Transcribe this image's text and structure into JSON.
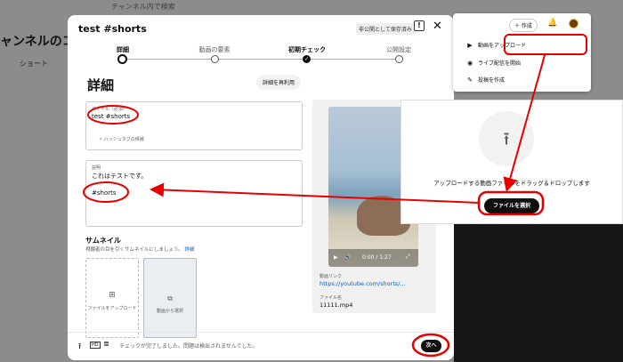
{
  "background": {
    "search_placeholder": "チャンネル内で検索",
    "channel_title": "ャンネルのコ",
    "tab_short": "ショート"
  },
  "dialog": {
    "title": "test #shorts",
    "saved_badge": "非公開として保存済み",
    "steps": [
      {
        "label": "詳細"
      },
      {
        "label": "動画の要素"
      },
      {
        "label": "初期チェック"
      },
      {
        "label": "公開設定"
      }
    ],
    "heading": "詳細",
    "reuse_button": "詳細を再利用",
    "title_field": {
      "label": "タイトル（必須）",
      "value": "test #shorts",
      "hint": "ハッシュタグの候補"
    },
    "description_field": {
      "label": "説明",
      "line1": "これはテストです。",
      "line2": "#shorts"
    },
    "thumbnail": {
      "heading": "サムネイル",
      "subtext": "視聴者の目を引くサムネイルにしましょう。",
      "link": "詳細",
      "upload_label": "ファイルをアップロード",
      "auto_label": "動画から選択"
    },
    "preview": {
      "time": "0:00 / 1:27",
      "link_label": "動画リンク",
      "link_url": "https://youtube.com/shorts/...",
      "file_label": "ファイル名",
      "file_name": "11111.mp4"
    },
    "footer": {
      "status": "チェックが完了しました。問題は検出されませんでした。",
      "next_button": "次へ"
    }
  },
  "create_menu": {
    "create_button": "作成",
    "items": [
      {
        "label": "動画をアップロード",
        "icon": "upload-video-icon"
      },
      {
        "label": "ライブ配信を開始",
        "icon": "live-icon"
      },
      {
        "label": "投稿を作成",
        "icon": "edit-post-icon"
      }
    ]
  },
  "upload_dialog": {
    "text": "アップロードする動画ファイルをドラッグ＆ドロップします",
    "select_button": "ファイルを選択"
  },
  "colors": {
    "accent_red": "#e60000",
    "link_blue": "#065fd4",
    "dark": "#0f0f0f"
  }
}
